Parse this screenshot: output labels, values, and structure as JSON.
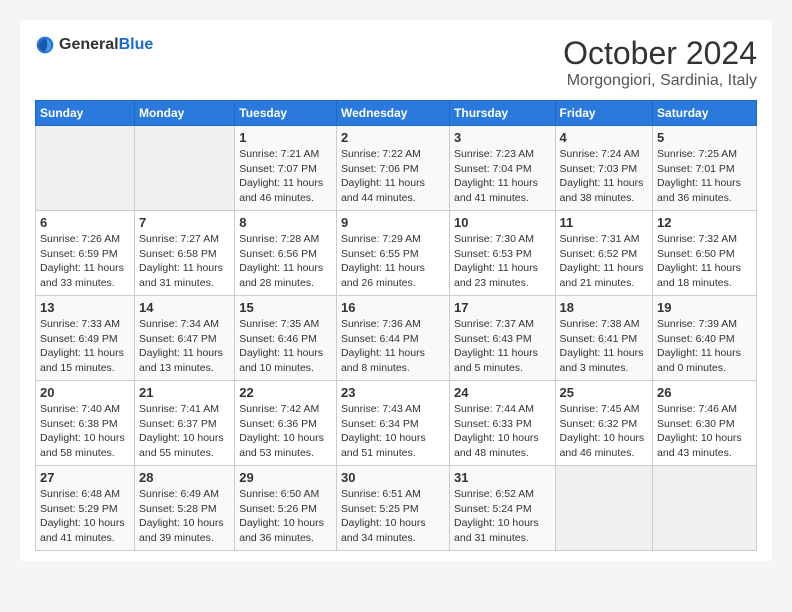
{
  "logo": {
    "general": "General",
    "blue": "Blue"
  },
  "title": "October 2024",
  "subtitle": "Morgongiori, Sardinia, Italy",
  "weekdays": [
    "Sunday",
    "Monday",
    "Tuesday",
    "Wednesday",
    "Thursday",
    "Friday",
    "Saturday"
  ],
  "weeks": [
    [
      {
        "day": "",
        "sunrise": "",
        "sunset": "",
        "daylight": ""
      },
      {
        "day": "",
        "sunrise": "",
        "sunset": "",
        "daylight": ""
      },
      {
        "day": "1",
        "sunrise": "Sunrise: 7:21 AM",
        "sunset": "Sunset: 7:07 PM",
        "daylight": "Daylight: 11 hours and 46 minutes."
      },
      {
        "day": "2",
        "sunrise": "Sunrise: 7:22 AM",
        "sunset": "Sunset: 7:06 PM",
        "daylight": "Daylight: 11 hours and 44 minutes."
      },
      {
        "day": "3",
        "sunrise": "Sunrise: 7:23 AM",
        "sunset": "Sunset: 7:04 PM",
        "daylight": "Daylight: 11 hours and 41 minutes."
      },
      {
        "day": "4",
        "sunrise": "Sunrise: 7:24 AM",
        "sunset": "Sunset: 7:03 PM",
        "daylight": "Daylight: 11 hours and 38 minutes."
      },
      {
        "day": "5",
        "sunrise": "Sunrise: 7:25 AM",
        "sunset": "Sunset: 7:01 PM",
        "daylight": "Daylight: 11 hours and 36 minutes."
      }
    ],
    [
      {
        "day": "6",
        "sunrise": "Sunrise: 7:26 AM",
        "sunset": "Sunset: 6:59 PM",
        "daylight": "Daylight: 11 hours and 33 minutes."
      },
      {
        "day": "7",
        "sunrise": "Sunrise: 7:27 AM",
        "sunset": "Sunset: 6:58 PM",
        "daylight": "Daylight: 11 hours and 31 minutes."
      },
      {
        "day": "8",
        "sunrise": "Sunrise: 7:28 AM",
        "sunset": "Sunset: 6:56 PM",
        "daylight": "Daylight: 11 hours and 28 minutes."
      },
      {
        "day": "9",
        "sunrise": "Sunrise: 7:29 AM",
        "sunset": "Sunset: 6:55 PM",
        "daylight": "Daylight: 11 hours and 26 minutes."
      },
      {
        "day": "10",
        "sunrise": "Sunrise: 7:30 AM",
        "sunset": "Sunset: 6:53 PM",
        "daylight": "Daylight: 11 hours and 23 minutes."
      },
      {
        "day": "11",
        "sunrise": "Sunrise: 7:31 AM",
        "sunset": "Sunset: 6:52 PM",
        "daylight": "Daylight: 11 hours and 21 minutes."
      },
      {
        "day": "12",
        "sunrise": "Sunrise: 7:32 AM",
        "sunset": "Sunset: 6:50 PM",
        "daylight": "Daylight: 11 hours and 18 minutes."
      }
    ],
    [
      {
        "day": "13",
        "sunrise": "Sunrise: 7:33 AM",
        "sunset": "Sunset: 6:49 PM",
        "daylight": "Daylight: 11 hours and 15 minutes."
      },
      {
        "day": "14",
        "sunrise": "Sunrise: 7:34 AM",
        "sunset": "Sunset: 6:47 PM",
        "daylight": "Daylight: 11 hours and 13 minutes."
      },
      {
        "day": "15",
        "sunrise": "Sunrise: 7:35 AM",
        "sunset": "Sunset: 6:46 PM",
        "daylight": "Daylight: 11 hours and 10 minutes."
      },
      {
        "day": "16",
        "sunrise": "Sunrise: 7:36 AM",
        "sunset": "Sunset: 6:44 PM",
        "daylight": "Daylight: 11 hours and 8 minutes."
      },
      {
        "day": "17",
        "sunrise": "Sunrise: 7:37 AM",
        "sunset": "Sunset: 6:43 PM",
        "daylight": "Daylight: 11 hours and 5 minutes."
      },
      {
        "day": "18",
        "sunrise": "Sunrise: 7:38 AM",
        "sunset": "Sunset: 6:41 PM",
        "daylight": "Daylight: 11 hours and 3 minutes."
      },
      {
        "day": "19",
        "sunrise": "Sunrise: 7:39 AM",
        "sunset": "Sunset: 6:40 PM",
        "daylight": "Daylight: 11 hours and 0 minutes."
      }
    ],
    [
      {
        "day": "20",
        "sunrise": "Sunrise: 7:40 AM",
        "sunset": "Sunset: 6:38 PM",
        "daylight": "Daylight: 10 hours and 58 minutes."
      },
      {
        "day": "21",
        "sunrise": "Sunrise: 7:41 AM",
        "sunset": "Sunset: 6:37 PM",
        "daylight": "Daylight: 10 hours and 55 minutes."
      },
      {
        "day": "22",
        "sunrise": "Sunrise: 7:42 AM",
        "sunset": "Sunset: 6:36 PM",
        "daylight": "Daylight: 10 hours and 53 minutes."
      },
      {
        "day": "23",
        "sunrise": "Sunrise: 7:43 AM",
        "sunset": "Sunset: 6:34 PM",
        "daylight": "Daylight: 10 hours and 51 minutes."
      },
      {
        "day": "24",
        "sunrise": "Sunrise: 7:44 AM",
        "sunset": "Sunset: 6:33 PM",
        "daylight": "Daylight: 10 hours and 48 minutes."
      },
      {
        "day": "25",
        "sunrise": "Sunrise: 7:45 AM",
        "sunset": "Sunset: 6:32 PM",
        "daylight": "Daylight: 10 hours and 46 minutes."
      },
      {
        "day": "26",
        "sunrise": "Sunrise: 7:46 AM",
        "sunset": "Sunset: 6:30 PM",
        "daylight": "Daylight: 10 hours and 43 minutes."
      }
    ],
    [
      {
        "day": "27",
        "sunrise": "Sunrise: 6:48 AM",
        "sunset": "Sunset: 5:29 PM",
        "daylight": "Daylight: 10 hours and 41 minutes."
      },
      {
        "day": "28",
        "sunrise": "Sunrise: 6:49 AM",
        "sunset": "Sunset: 5:28 PM",
        "daylight": "Daylight: 10 hours and 39 minutes."
      },
      {
        "day": "29",
        "sunrise": "Sunrise: 6:50 AM",
        "sunset": "Sunset: 5:26 PM",
        "daylight": "Daylight: 10 hours and 36 minutes."
      },
      {
        "day": "30",
        "sunrise": "Sunrise: 6:51 AM",
        "sunset": "Sunset: 5:25 PM",
        "daylight": "Daylight: 10 hours and 34 minutes."
      },
      {
        "day": "31",
        "sunrise": "Sunrise: 6:52 AM",
        "sunset": "Sunset: 5:24 PM",
        "daylight": "Daylight: 10 hours and 31 minutes."
      },
      {
        "day": "",
        "sunrise": "",
        "sunset": "",
        "daylight": ""
      },
      {
        "day": "",
        "sunrise": "",
        "sunset": "",
        "daylight": ""
      }
    ]
  ]
}
